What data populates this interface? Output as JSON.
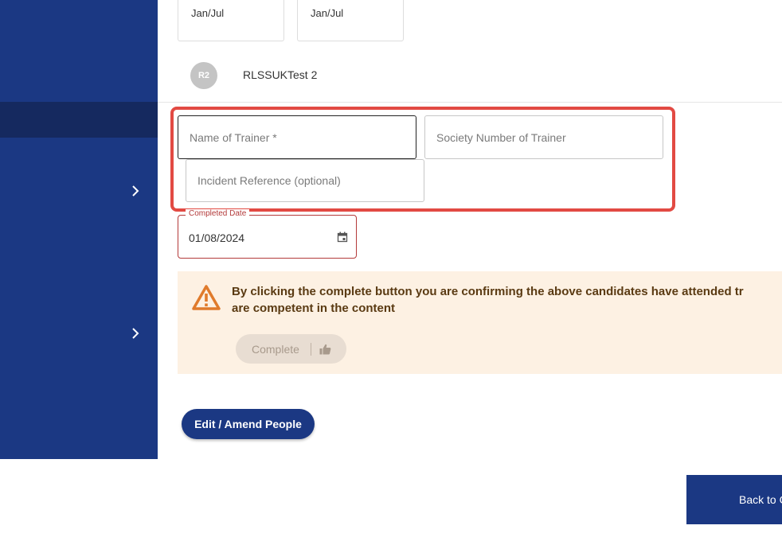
{
  "months": [
    {
      "label": "Jan/Jul"
    },
    {
      "label": "Jan/Jul"
    }
  ],
  "person": {
    "initials": "R2",
    "name": "RLSSUKTest 2"
  },
  "trainer_form": {
    "name_placeholder": "Name of Trainer *",
    "society_number_placeholder": "Society Number of Trainer",
    "incident_reference_placeholder": "Incident Reference (optional)"
  },
  "completed_date": {
    "label": "Completed Date",
    "value": "01/08/2024"
  },
  "warning": {
    "text": "By clicking the complete button you are confirming the above candidates have attended tr are competent in the content",
    "line1": "By clicking the complete button you are confirming the above candidates have attended tr",
    "line2": "are competent in the content"
  },
  "buttons": {
    "complete": "Complete",
    "edit_amend": "Edit / Amend People",
    "back": "Back to C"
  },
  "colors": {
    "brand": "#1b3883",
    "highlight": "#e24a43",
    "warning_bg": "#fdf1e3",
    "warning_icon": "#e07b2c"
  },
  "icons": {
    "sidebar_chevron": "chevron-right-icon",
    "calendar": "calendar-icon",
    "warning": "warning-triangle-icon",
    "complete": "thumbs-up-icon"
  }
}
